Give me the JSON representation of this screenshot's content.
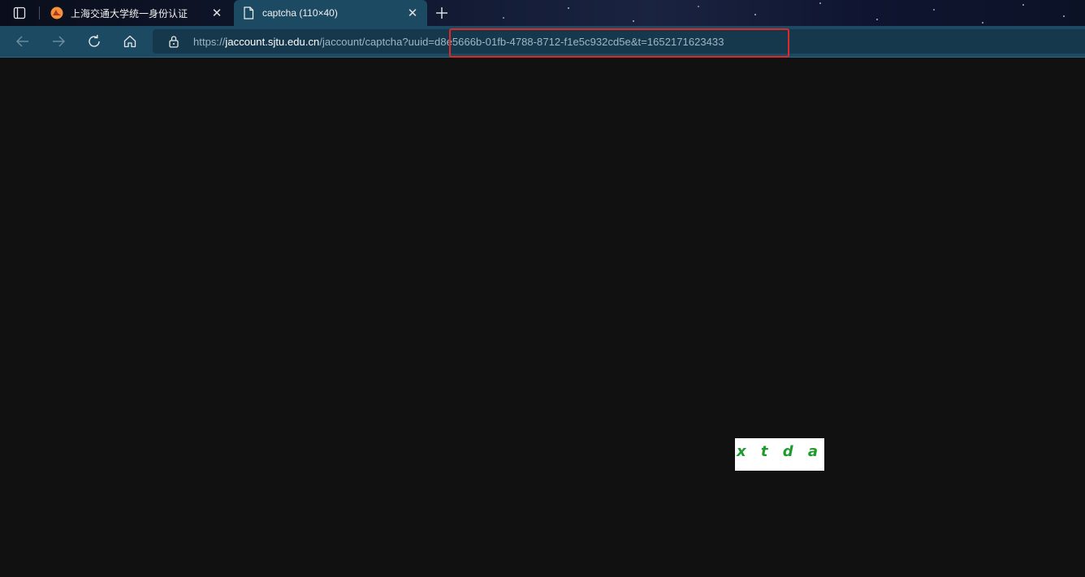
{
  "tabs": [
    {
      "title": "上海交通大学统一身份认证",
      "icon": "sjtu-logo-icon",
      "active": false
    },
    {
      "title": "captcha (110×40)",
      "icon": "page-icon",
      "active": true
    }
  ],
  "address_bar": {
    "url_prefix": "https://",
    "url_host": "jaccount.sjtu.edu.cn",
    "url_path": "/jaccount/captcha?uuid=d8e5666b-01fb-4788-8712-f1e5c932cd5e&t=1652171623433"
  },
  "captcha": {
    "text": "x t d a"
  },
  "colors": {
    "toolbar": "#1d4a63",
    "highlight": "#e02828",
    "captcha_text": "#1f9a2e"
  }
}
